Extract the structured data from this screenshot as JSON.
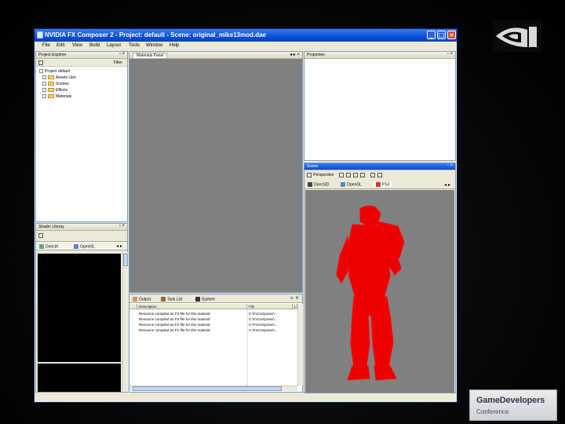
{
  "window": {
    "title": "NVIDIA FX Composer 2 - Project: default - Scene: original_mike13mod.dae",
    "controls": [
      "_",
      "□",
      "×"
    ]
  },
  "menu": [
    "File",
    "Edit",
    "View",
    "Build",
    "Layout",
    "Tools",
    "Window",
    "Help"
  ],
  "project_explorer": {
    "title": "Project Explorer",
    "filter_label": "Filter",
    "items": [
      {
        "label": "Project default",
        "kind": "root"
      },
      {
        "label": "Assets Libs",
        "kind": "folder"
      },
      {
        "label": "Scenes",
        "kind": "folder"
      },
      {
        "label": "Effects",
        "kind": "folder"
      },
      {
        "label": "Materials",
        "kind": "folder"
      }
    ]
  },
  "shader_library": {
    "title": "Shader Library",
    "tabs": [
      "DirectX",
      "OpenGL"
    ]
  },
  "render_panel": {
    "title": "Materials Panel"
  },
  "properties_panel": {
    "title": "Properties"
  },
  "scene_panel": {
    "title": "Scene",
    "toolbar_label": "Perspective",
    "tabs": [
      "Direct3D",
      "OpenGL",
      "PS3"
    ]
  },
  "output_panel": {
    "tabs": [
      "Output",
      "Task List",
      "System"
    ],
    "columns": [
      "Description",
      "File",
      "L"
    ],
    "rows": [
      {
        "description": "Resource compiled as FX file for this material",
        "file": "C:\\FxComposer\\..."
      },
      {
        "description": "Resource compiled as FX file for this material",
        "file": "C:\\FxComposer\\..."
      },
      {
        "description": "Resource compiled as FX file for this material",
        "file": "C:\\FxComposer\\..."
      },
      {
        "description": "Resource compiled as FX file for this material",
        "file": "C:\\FxComposer\\..."
      }
    ]
  },
  "badge": {
    "line1": "GameDevelopers",
    "line2": "Conference"
  },
  "colors": {
    "model_wireframe": "#ff0000",
    "viewport_bg": "#808080",
    "title_bar": "#0a4fd6"
  }
}
